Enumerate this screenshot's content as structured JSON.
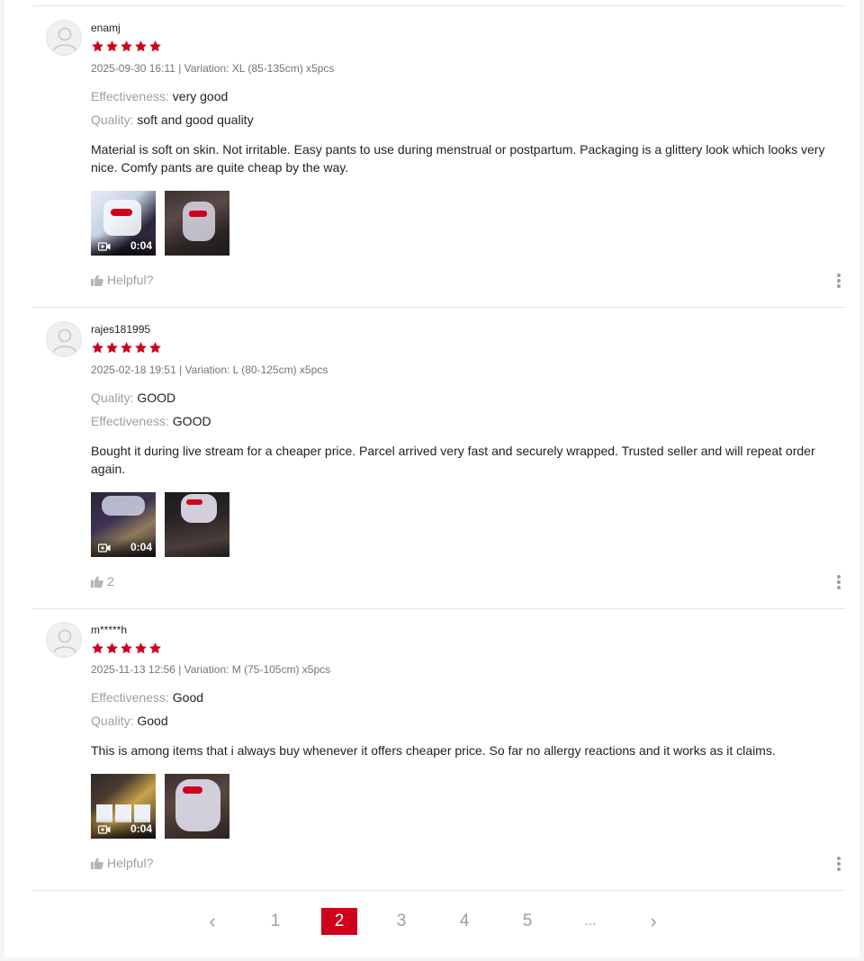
{
  "reviews": [
    {
      "username": "enamj",
      "rating": 5,
      "meta": "2025-09-30 16:11 | Variation: XL (85-135cm) x5pcs",
      "attributes": [
        {
          "key": "Effectiveness:",
          "value": "very good"
        },
        {
          "key": "Quality:",
          "value": "soft and good quality"
        }
      ],
      "text": "Material is soft on skin. Not irritable. Easy pants to use during menstrual or postpartum. Packaging is a glittery look which looks very nice. Comfy pants are quite cheap by the way.",
      "video_duration": "0:04",
      "helpful_label": "Helpful?"
    },
    {
      "username": "rajes181995",
      "rating": 5,
      "meta": "2025-02-18 19:51 | Variation: L (80-125cm) x5pcs",
      "attributes": [
        {
          "key": "Quality:",
          "value": "GOOD"
        },
        {
          "key": "Effectiveness:",
          "value": "GOOD"
        }
      ],
      "text": "Bought it during live stream for a cheaper price. Parcel arrived very fast and securely wrapped. Trusted seller and will repeat order again.",
      "video_duration": "0:04",
      "helpful_label": "2"
    },
    {
      "username": "m*****h",
      "rating": 5,
      "meta": "2025-11-13 12:56 | Variation: M (75-105cm) x5pcs",
      "attributes": [
        {
          "key": "Effectiveness:",
          "value": "Good"
        },
        {
          "key": "Quality:",
          "value": "Good"
        }
      ],
      "text": "This is among items that i always buy whenever it offers cheaper price. So far no allergy reactions and it works as it claims.",
      "video_duration": "0:04",
      "helpful_label": "Helpful?"
    }
  ],
  "pagination": {
    "prev": "‹",
    "pages": [
      "1",
      "2",
      "3",
      "4",
      "5",
      "..."
    ],
    "current": "2",
    "next": "›"
  },
  "icons": {
    "star": "star-icon",
    "avatar": "user-avatar-icon",
    "video": "video-camera-icon",
    "helpful": "thumbs-up-icon",
    "more": "more-vertical-icon"
  },
  "colors": {
    "accent": "#d0011b",
    "star": "#d0011b",
    "muted": "#9e9e9e"
  }
}
